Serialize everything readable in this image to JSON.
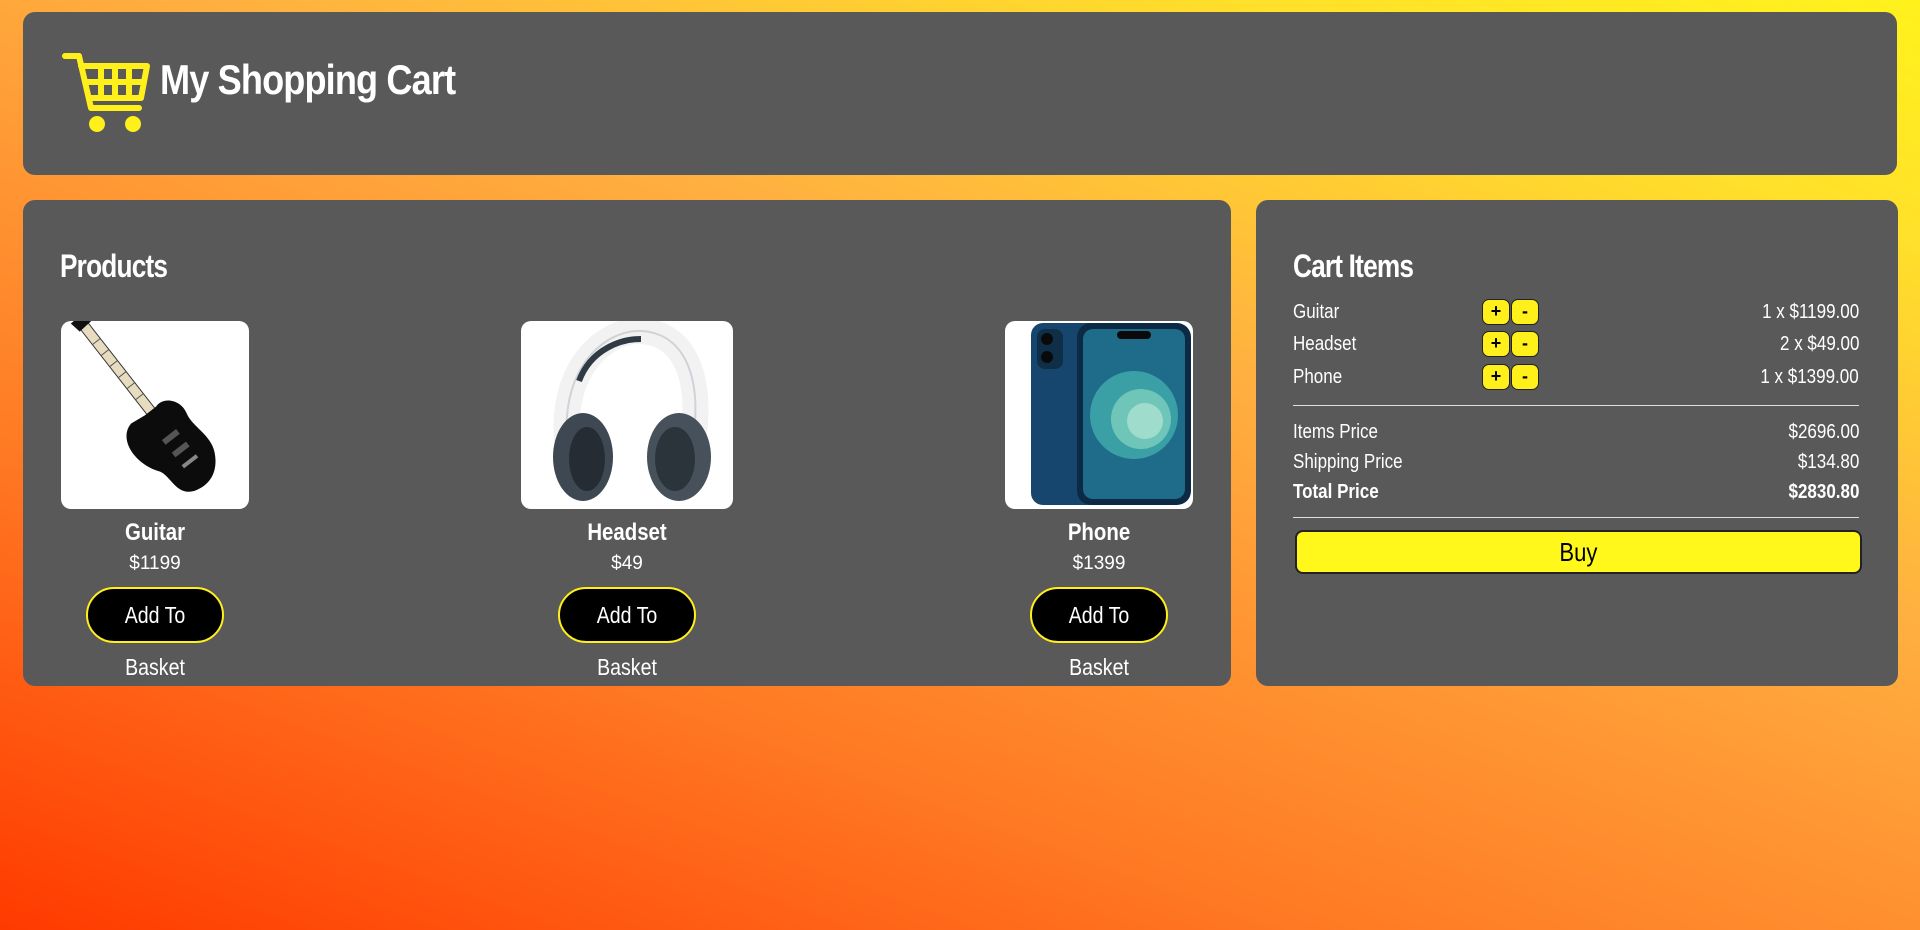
{
  "header": {
    "title": "My Shopping Cart",
    "logo_icon": "shopping-cart-icon",
    "logo_color": "#ffef1a"
  },
  "products": {
    "heading": "Products",
    "items": [
      {
        "name": "Guitar",
        "price": "$1199",
        "button": "Add To Basket",
        "image_icon": "guitar-icon"
      },
      {
        "name": "Headset",
        "price": "$49",
        "button": "Add To Basket",
        "image_icon": "headset-icon"
      },
      {
        "name": "Phone",
        "price": "$1399",
        "button": "Add To Basket",
        "image_icon": "phone-icon"
      }
    ]
  },
  "cart": {
    "heading": "Cart Items",
    "plus_label": "+",
    "minus_label": "-",
    "items": [
      {
        "name": "Guitar",
        "qty_text": "1 x $1199.00"
      },
      {
        "name": "Headset",
        "qty_text": "2 x $49.00"
      },
      {
        "name": "Phone",
        "qty_text": "1 x $1399.00"
      }
    ],
    "summary": {
      "items_label": "Items Price",
      "items_value": "$2696.00",
      "shipping_label": "Shipping Price",
      "shipping_value": "$134.80",
      "total_label": "Total Price",
      "total_value": "$2830.80"
    },
    "buy_label": "Buy"
  },
  "colors": {
    "panel": "#595959",
    "accent": "#ffef1a",
    "button_dark": "#000000"
  }
}
